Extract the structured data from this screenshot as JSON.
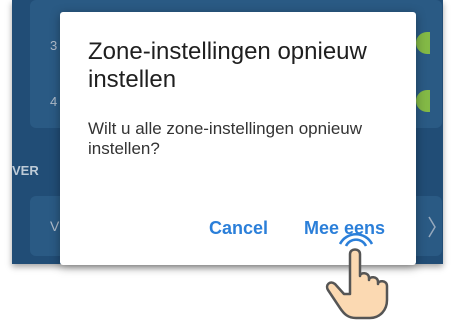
{
  "background": {
    "zone_rows": [
      {
        "number": "3"
      },
      {
        "number": "4"
      }
    ],
    "section_label": "VER",
    "row_letter": "V"
  },
  "dialog": {
    "title": "Zone-instellingen opnieuw instellen",
    "message": "Wilt u alle zone-instellingen opnieuw instellen?",
    "cancel_label": "Cancel",
    "agree_label": "Mee eens"
  },
  "colors": {
    "app_background": "#23527d",
    "card": "#2d5f8c",
    "toggle": "#8bc34a",
    "accent": "#2b7fd9",
    "hand_fill": "#fbd9b2",
    "hand_stroke": "#555555"
  },
  "icons": {
    "toggle": "toggle-switch-icon",
    "chevron": "chevron-right-icon",
    "pointer": "tap-hand-icon"
  }
}
